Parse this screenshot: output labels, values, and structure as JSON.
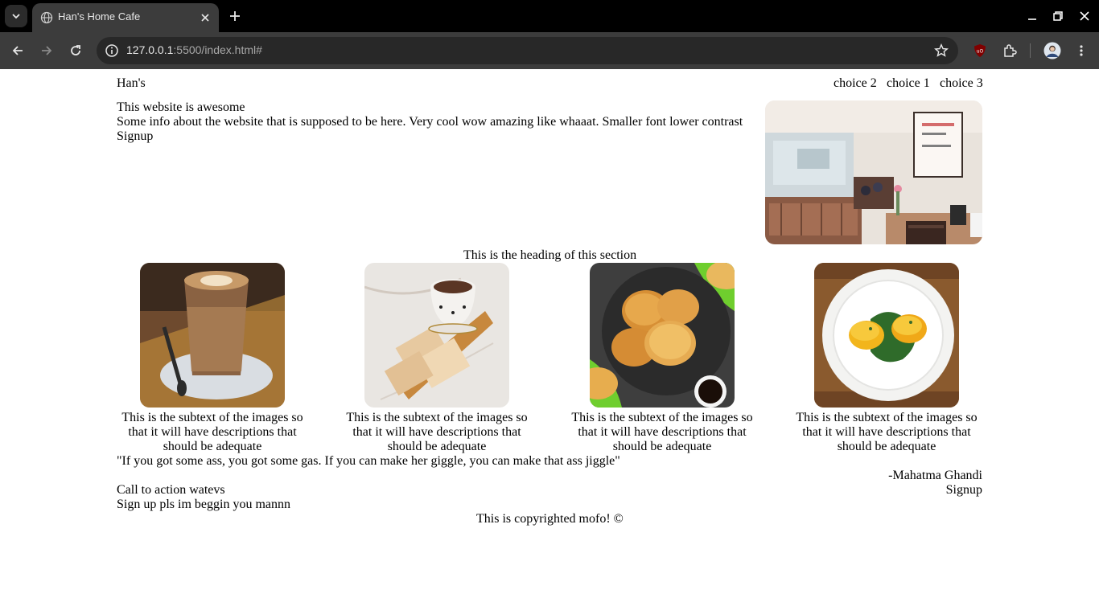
{
  "browser": {
    "tab_title": "Han's Home Cafe",
    "url_host": "127.0.0.1",
    "url_rest": ":5500/index.html#"
  },
  "header": {
    "brand": "Han's",
    "nav": [
      "choice 2",
      "choice 1",
      "choice 3"
    ]
  },
  "hero": {
    "title": "This website is awesome",
    "description": "Some info about the website that is supposed to be here. Very cool wow amazing like whaaat. Smaller font lower contrast",
    "cta": "Signup",
    "image_alt": "cafe interior photo"
  },
  "section": {
    "heading": "This is the heading of this section",
    "cards": [
      {
        "image": "latte-photo",
        "caption": "This is the subtext of the images so that it will have descriptions that should be adequate"
      },
      {
        "image": "cocoa-biscuits-photo",
        "caption": "This is the subtext of the images so that it will have descriptions that should be adequate"
      },
      {
        "image": "pancakes-photo",
        "caption": "This is the subtext of the images so that it will have descriptions that should be adequate"
      },
      {
        "image": "eggs-benedict-photo",
        "caption": "This is the subtext of the images so that it will have descriptions that should be adequate"
      }
    ]
  },
  "testimonial": {
    "quote": "\"If you got some ass, you got some gas. If you can make her giggle, you can make that ass jiggle\"",
    "author": "-Mahatma Ghandi",
    "cta": "Signup"
  },
  "cta_section": {
    "title": "Call to action watevs",
    "text": "Sign up pls im beggin you mannn"
  },
  "footer": {
    "copyright": "This is copyrighted mofo! ©"
  }
}
